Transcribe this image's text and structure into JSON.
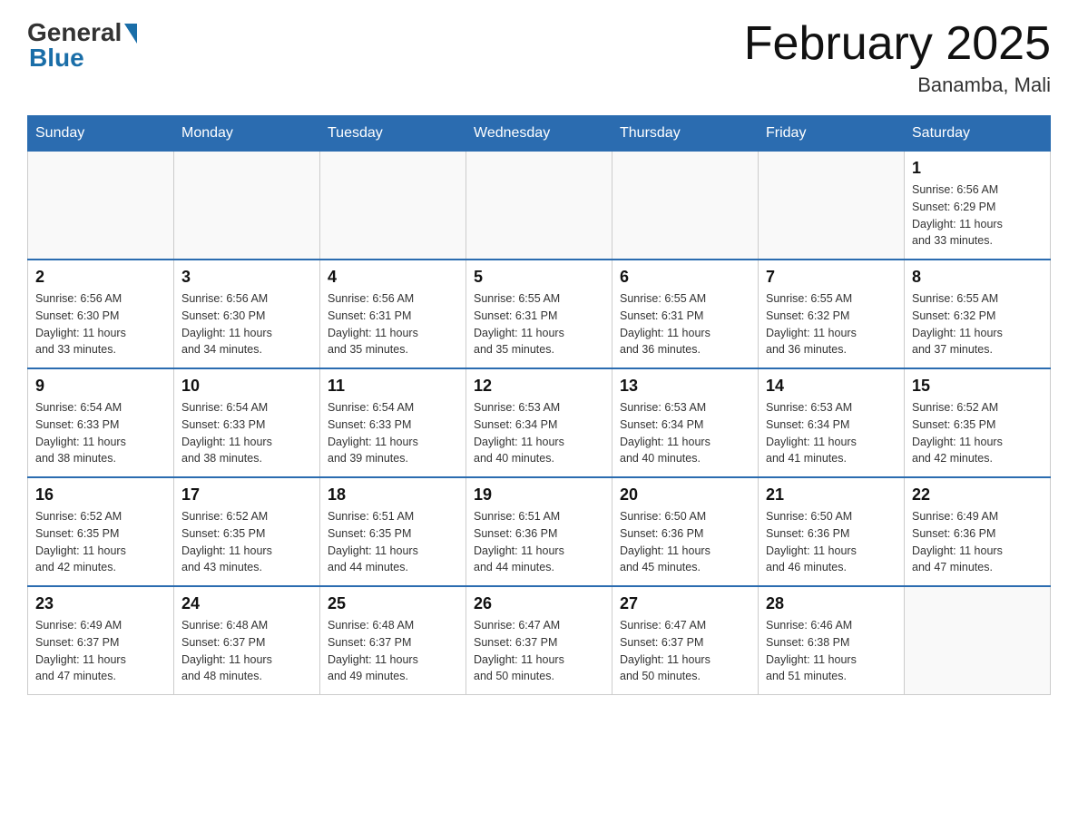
{
  "header": {
    "logo_general": "General",
    "logo_blue": "Blue",
    "title": "February 2025",
    "subtitle": "Banamba, Mali"
  },
  "calendar": {
    "days_of_week": [
      "Sunday",
      "Monday",
      "Tuesday",
      "Wednesday",
      "Thursday",
      "Friday",
      "Saturday"
    ],
    "weeks": [
      [
        {
          "day": "",
          "info": ""
        },
        {
          "day": "",
          "info": ""
        },
        {
          "day": "",
          "info": ""
        },
        {
          "day": "",
          "info": ""
        },
        {
          "day": "",
          "info": ""
        },
        {
          "day": "",
          "info": ""
        },
        {
          "day": "1",
          "info": "Sunrise: 6:56 AM\nSunset: 6:29 PM\nDaylight: 11 hours\nand 33 minutes."
        }
      ],
      [
        {
          "day": "2",
          "info": "Sunrise: 6:56 AM\nSunset: 6:30 PM\nDaylight: 11 hours\nand 33 minutes."
        },
        {
          "day": "3",
          "info": "Sunrise: 6:56 AM\nSunset: 6:30 PM\nDaylight: 11 hours\nand 34 minutes."
        },
        {
          "day": "4",
          "info": "Sunrise: 6:56 AM\nSunset: 6:31 PM\nDaylight: 11 hours\nand 35 minutes."
        },
        {
          "day": "5",
          "info": "Sunrise: 6:55 AM\nSunset: 6:31 PM\nDaylight: 11 hours\nand 35 minutes."
        },
        {
          "day": "6",
          "info": "Sunrise: 6:55 AM\nSunset: 6:31 PM\nDaylight: 11 hours\nand 36 minutes."
        },
        {
          "day": "7",
          "info": "Sunrise: 6:55 AM\nSunset: 6:32 PM\nDaylight: 11 hours\nand 36 minutes."
        },
        {
          "day": "8",
          "info": "Sunrise: 6:55 AM\nSunset: 6:32 PM\nDaylight: 11 hours\nand 37 minutes."
        }
      ],
      [
        {
          "day": "9",
          "info": "Sunrise: 6:54 AM\nSunset: 6:33 PM\nDaylight: 11 hours\nand 38 minutes."
        },
        {
          "day": "10",
          "info": "Sunrise: 6:54 AM\nSunset: 6:33 PM\nDaylight: 11 hours\nand 38 minutes."
        },
        {
          "day": "11",
          "info": "Sunrise: 6:54 AM\nSunset: 6:33 PM\nDaylight: 11 hours\nand 39 minutes."
        },
        {
          "day": "12",
          "info": "Sunrise: 6:53 AM\nSunset: 6:34 PM\nDaylight: 11 hours\nand 40 minutes."
        },
        {
          "day": "13",
          "info": "Sunrise: 6:53 AM\nSunset: 6:34 PM\nDaylight: 11 hours\nand 40 minutes."
        },
        {
          "day": "14",
          "info": "Sunrise: 6:53 AM\nSunset: 6:34 PM\nDaylight: 11 hours\nand 41 minutes."
        },
        {
          "day": "15",
          "info": "Sunrise: 6:52 AM\nSunset: 6:35 PM\nDaylight: 11 hours\nand 42 minutes."
        }
      ],
      [
        {
          "day": "16",
          "info": "Sunrise: 6:52 AM\nSunset: 6:35 PM\nDaylight: 11 hours\nand 42 minutes."
        },
        {
          "day": "17",
          "info": "Sunrise: 6:52 AM\nSunset: 6:35 PM\nDaylight: 11 hours\nand 43 minutes."
        },
        {
          "day": "18",
          "info": "Sunrise: 6:51 AM\nSunset: 6:35 PM\nDaylight: 11 hours\nand 44 minutes."
        },
        {
          "day": "19",
          "info": "Sunrise: 6:51 AM\nSunset: 6:36 PM\nDaylight: 11 hours\nand 44 minutes."
        },
        {
          "day": "20",
          "info": "Sunrise: 6:50 AM\nSunset: 6:36 PM\nDaylight: 11 hours\nand 45 minutes."
        },
        {
          "day": "21",
          "info": "Sunrise: 6:50 AM\nSunset: 6:36 PM\nDaylight: 11 hours\nand 46 minutes."
        },
        {
          "day": "22",
          "info": "Sunrise: 6:49 AM\nSunset: 6:36 PM\nDaylight: 11 hours\nand 47 minutes."
        }
      ],
      [
        {
          "day": "23",
          "info": "Sunrise: 6:49 AM\nSunset: 6:37 PM\nDaylight: 11 hours\nand 47 minutes."
        },
        {
          "day": "24",
          "info": "Sunrise: 6:48 AM\nSunset: 6:37 PM\nDaylight: 11 hours\nand 48 minutes."
        },
        {
          "day": "25",
          "info": "Sunrise: 6:48 AM\nSunset: 6:37 PM\nDaylight: 11 hours\nand 49 minutes."
        },
        {
          "day": "26",
          "info": "Sunrise: 6:47 AM\nSunset: 6:37 PM\nDaylight: 11 hours\nand 50 minutes."
        },
        {
          "day": "27",
          "info": "Sunrise: 6:47 AM\nSunset: 6:37 PM\nDaylight: 11 hours\nand 50 minutes."
        },
        {
          "day": "28",
          "info": "Sunrise: 6:46 AM\nSunset: 6:38 PM\nDaylight: 11 hours\nand 51 minutes."
        },
        {
          "day": "",
          "info": ""
        }
      ]
    ]
  }
}
